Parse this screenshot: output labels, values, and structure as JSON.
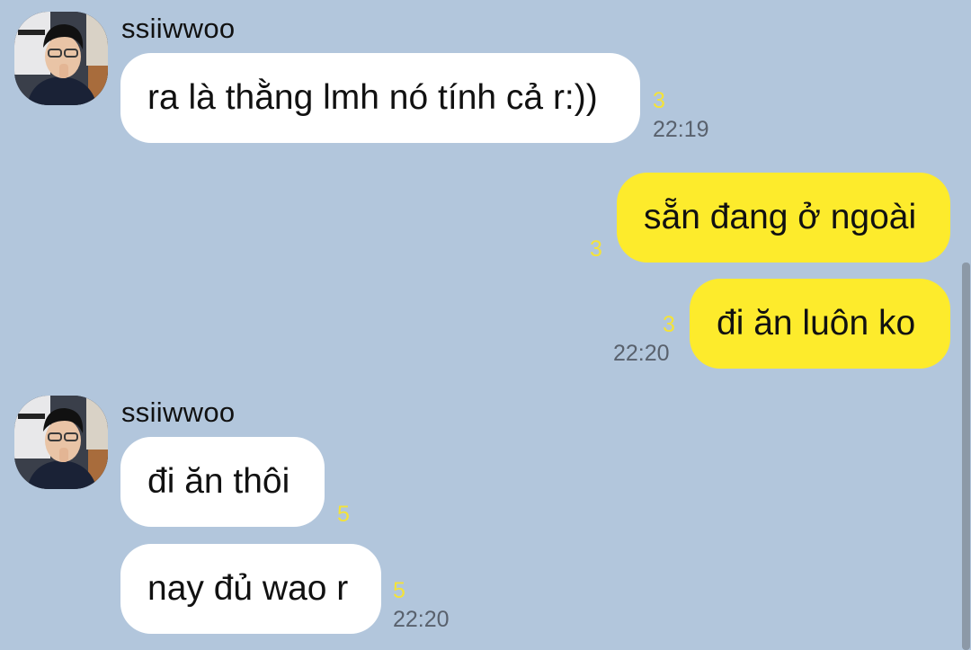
{
  "messages": [
    {
      "sender": "ssiiwwoo",
      "text": "ra là thằng lmh nó tính cả r:))",
      "unread": "3",
      "time": "22:19"
    },
    {
      "text": "sẵn đang ở ngoài",
      "unread": "3"
    },
    {
      "text": "đi ăn luôn ko",
      "unread": "3",
      "time": "22:20"
    },
    {
      "sender": "ssiiwwoo",
      "text": "đi ăn thôi",
      "unread": "5"
    },
    {
      "text": "nay đủ wao r",
      "unread": "5",
      "time": "22:20"
    }
  ],
  "colors": {
    "background": "#b2c6dc",
    "incoming_bubble": "#ffffff",
    "outgoing_bubble": "#fdeb2c",
    "unread_count": "#f4e338",
    "timestamp": "#59616d"
  },
  "icons": {
    "avatar": "profile-photo"
  }
}
